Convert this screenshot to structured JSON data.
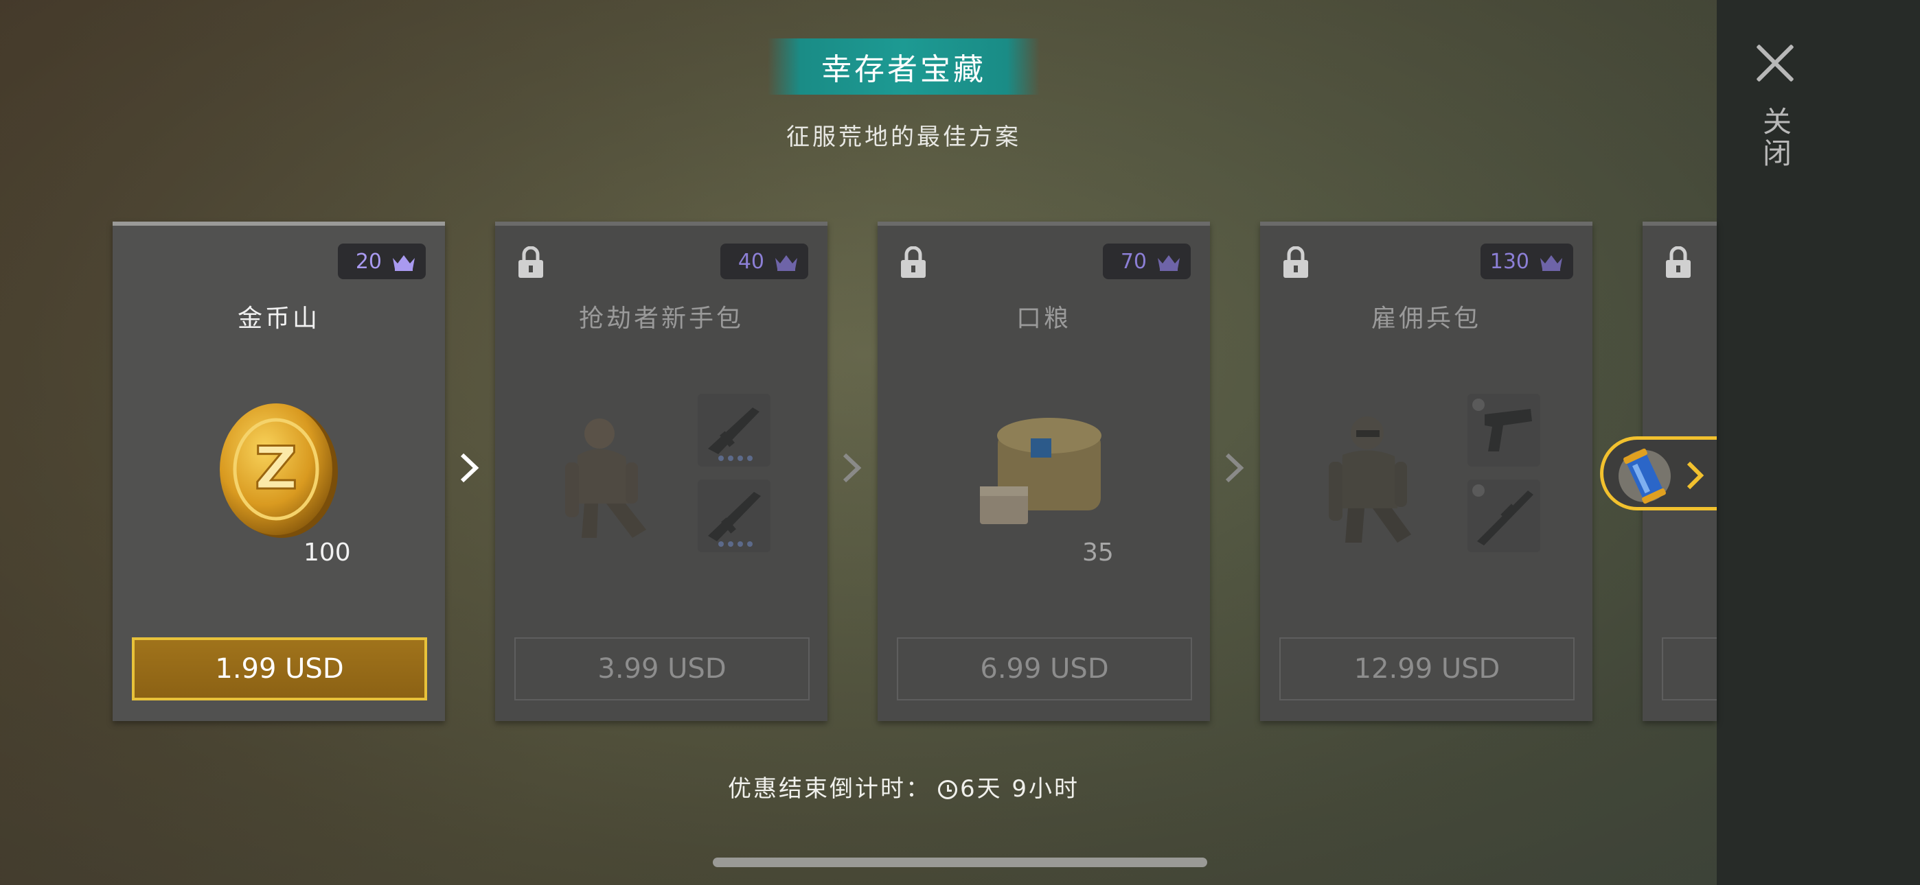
{
  "header": {
    "title": "幸存者宝藏",
    "subtitle": "征服荒地的最佳方案"
  },
  "close": {
    "label": "关闭"
  },
  "cards": [
    {
      "name": "金币山",
      "crown": "20",
      "price": "1.99 USD",
      "qty": "100",
      "locked": false
    },
    {
      "name": "抢劫者新手包",
      "crown": "40",
      "price": "3.99 USD",
      "locked": true
    },
    {
      "name": "口粮",
      "crown": "70",
      "price": "6.99 USD",
      "qty": "35",
      "locked": true
    },
    {
      "name": "雇佣兵包",
      "crown": "130",
      "price": "12.99 USD",
      "locked": true
    }
  ],
  "timer": {
    "label": "优惠结束倒计时：",
    "value": "6天 9小时"
  },
  "colors": {
    "accent_teal": "#1d9a93",
    "buy_gold": "#a0731b",
    "gold_border": "#e8c23a",
    "crown_purple": "#a99af0"
  },
  "icons": [
    "close-icon",
    "crown-icon",
    "lock-icon",
    "chevron-right-icon",
    "clock-icon",
    "coin-icon",
    "canister-icon"
  ]
}
